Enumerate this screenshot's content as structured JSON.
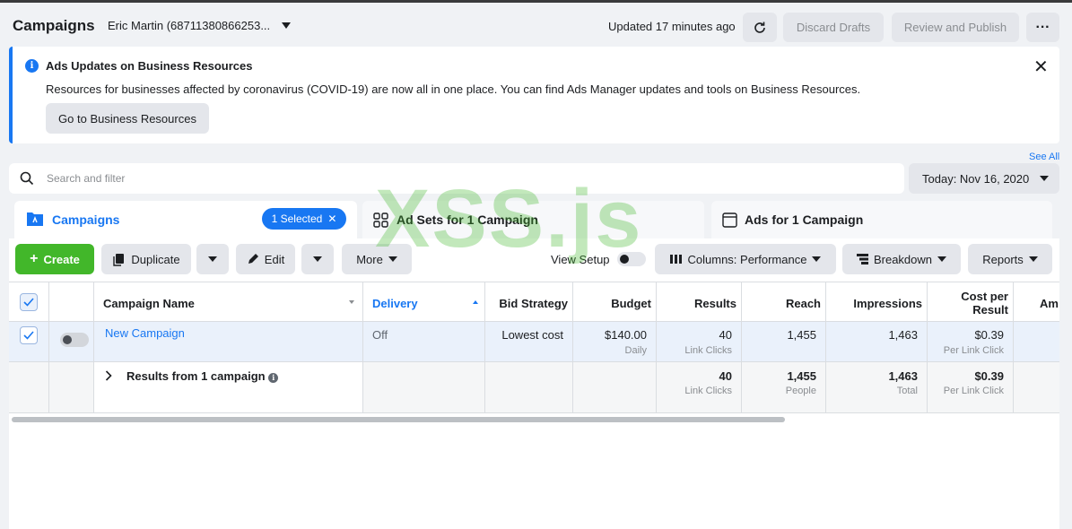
{
  "header": {
    "title": "Campaigns",
    "account": "Eric Martin (68711380866253...",
    "updated": "Updated 17 minutes ago",
    "discard_label": "Discard Drafts",
    "publish_label": "Review and Publish",
    "more_label": "···"
  },
  "banner": {
    "title": "Ads Updates on Business Resources",
    "text": "Resources for businesses affected by coronavirus (COVID-19) are now all in one place. You can find Ads Manager updates and tools on Business Resources.",
    "button_label": "Go to Business Resources",
    "close_glyph": "✕"
  },
  "see_all": "See All",
  "search": {
    "placeholder": "Search and filter"
  },
  "date_range": "Today: Nov 16, 2020",
  "tabs": {
    "campaigns": {
      "label": "Campaigns",
      "pill": "1 Selected"
    },
    "adsets": {
      "label": "Ad Sets for 1 Campaign"
    },
    "ads": {
      "label": "Ads for 1 Campaign"
    }
  },
  "toolbar": {
    "create": "Create",
    "duplicate": "Duplicate",
    "edit": "Edit",
    "more": "More",
    "view_setup": "View Setup",
    "columns": "Columns: Performance",
    "breakdown": "Breakdown",
    "reports": "Reports"
  },
  "table": {
    "columns": [
      "Campaign Name",
      "Delivery",
      "Bid Strategy",
      "Budget",
      "Results",
      "Reach",
      "Impressions",
      "Cost per Result",
      "Am"
    ],
    "cost_per_line1": "Cost per",
    "cost_per_line2": "Result",
    "row": {
      "name": "New Campaign",
      "delivery": "Off",
      "bid": "Lowest cost",
      "budget": "$140.00",
      "budget_sub": "Daily",
      "results": "40",
      "results_sub": "Link Clicks",
      "reach": "1,455",
      "impressions": "1,463",
      "cost": "$0.39",
      "cost_sub": "Per Link Click"
    },
    "summary": {
      "label": "Results from 1 campaign",
      "results": "40",
      "results_sub": "Link Clicks",
      "reach": "1,455",
      "reach_sub": "People",
      "impressions": "1,463",
      "impressions_sub": "Total",
      "cost": "$0.39",
      "cost_sub": "Per Link Click"
    }
  },
  "watermark": "XSS.js",
  "colors": {
    "accent": "#1877f2",
    "create": "#42b72a"
  }
}
